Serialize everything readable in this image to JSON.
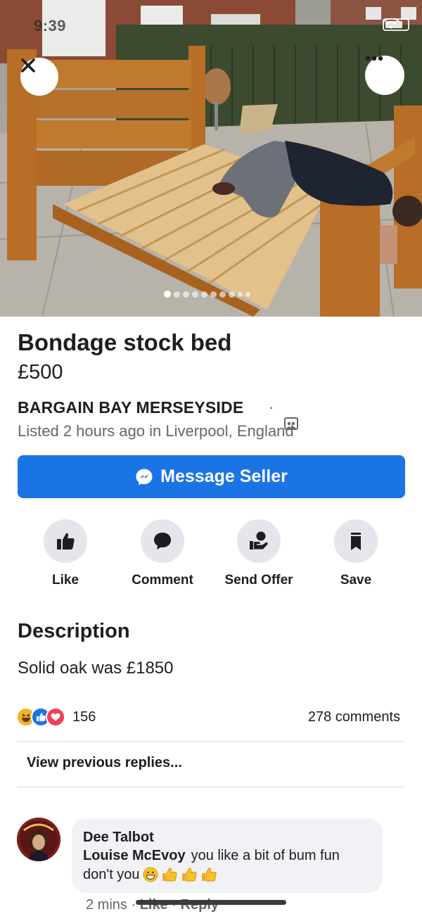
{
  "status_bar": {
    "time": "9:39"
  },
  "photo": {
    "image_count": 10,
    "active_index": 0
  },
  "listing": {
    "title": "Bondage stock bed",
    "price": "£500",
    "seller": "BARGAIN BAY MERSEYSIDE",
    "seller_separator": "·",
    "listed": "Listed 2 hours ago in Liverpool, England"
  },
  "message_button": {
    "label": "Message Seller"
  },
  "actions": [
    {
      "label": "Like",
      "icon": "thumbs-up-icon"
    },
    {
      "label": "Comment",
      "icon": "speech-bubble-icon"
    },
    {
      "label": "Send Offer",
      "icon": "hand-coin-icon"
    },
    {
      "label": "Save",
      "icon": "bookmark-icon"
    }
  ],
  "description": {
    "heading": "Description",
    "text": "Solid oak was £1850"
  },
  "engagement": {
    "reaction_count": "156",
    "comment_count": "278 comments",
    "reaction_icons": [
      "haha-icon",
      "like-icon",
      "love-icon"
    ]
  },
  "view_previous": "View previous replies...",
  "comment": {
    "author": "Dee Talbot",
    "mention": "Louise McEvoy",
    "text_line1": "you like a bit of bum fun",
    "text_line2": "don't you",
    "emojis": [
      "grin-icon",
      "thumbs-up-emoji",
      "thumbs-up-emoji",
      "thumbs-up-emoji"
    ],
    "time": "2 mins",
    "like_label": "Like",
    "reply_label": "Reply",
    "separator": "·"
  },
  "colors": {
    "accent_blue": "#1b74e4",
    "text_primary": "#1c1e21",
    "text_secondary": "#65676b",
    "action_circle": "#e4e6eb",
    "bubble": "#f0f2f5"
  }
}
